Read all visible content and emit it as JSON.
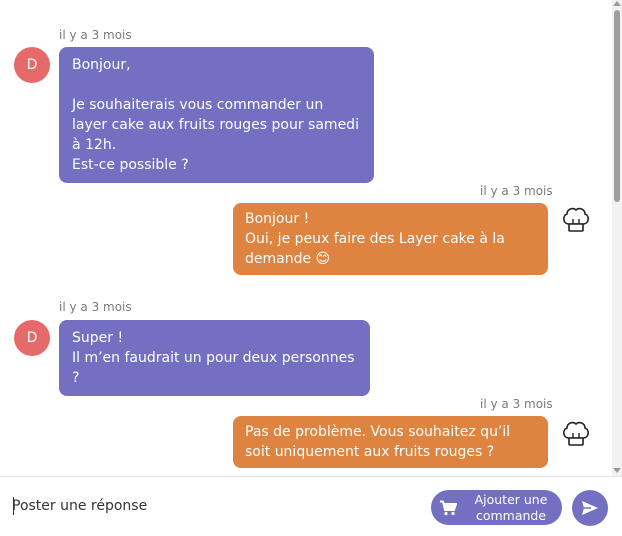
{
  "messages": [
    {
      "time": "il y a 3 mois",
      "avatar_letter": "D",
      "text": "Bonjour,\n\nJe souhaiterais vous commander un layer cake aux fruits rouges pour samedi à 12h.\nEst-ce possible ?"
    },
    {
      "time": "il y a 3 mois",
      "text": "Bonjour !\nOui, je peux faire des Layer cake à la demande 😊"
    },
    {
      "time": "il y a 3 mois",
      "avatar_letter": "D",
      "text": "Super !\nIl m’en faudrait un pour deux personnes ?"
    },
    {
      "time": "il y a 3 mois",
      "text": "Pas de problème. Vous souhaitez qu’il soit uniquement aux fruits rouges ?"
    }
  ],
  "composer": {
    "placeholder": "Poster une réponse",
    "order_button_label": "Ajouter une commande",
    "cart_icon": "cart-icon",
    "send_icon": "send-icon"
  },
  "colors": {
    "customer_bubble": "#7370c2",
    "baker_bubble": "#de8440",
    "avatar": "#e66a6a",
    "accent": "#7370c2"
  }
}
